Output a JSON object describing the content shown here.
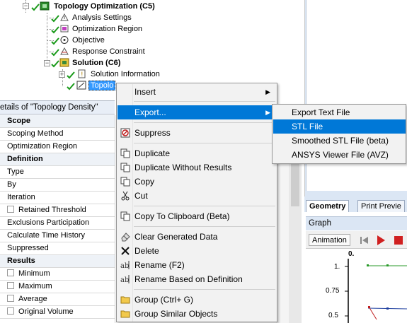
{
  "tree": {
    "nodes": [
      {
        "label": "Topology Optimization (C5)",
        "bold": true
      },
      {
        "label": "Analysis Settings",
        "bold": false
      },
      {
        "label": "Optimization Region",
        "bold": false
      },
      {
        "label": "Objective",
        "bold": false
      },
      {
        "label": "Response Constraint",
        "bold": false
      },
      {
        "label": "Solution (C6)",
        "bold": true
      },
      {
        "label": "Solution Information",
        "bold": false
      },
      {
        "label": "Topolo",
        "bold": false
      }
    ]
  },
  "details": {
    "title": "etails of \"Topology Density\"",
    "rows": [
      {
        "label": "Scope",
        "section": true,
        "checkbox": false
      },
      {
        "label": "Scoping Method",
        "section": false,
        "checkbox": false
      },
      {
        "label": "Optimization Region",
        "section": false,
        "checkbox": false
      },
      {
        "label": "Definition",
        "section": true,
        "checkbox": false
      },
      {
        "label": "Type",
        "section": false,
        "checkbox": false
      },
      {
        "label": "By",
        "section": false,
        "checkbox": false
      },
      {
        "label": "Iteration",
        "section": false,
        "checkbox": false
      },
      {
        "label": "Retained Threshold",
        "section": false,
        "checkbox": true
      },
      {
        "label": "Exclusions Participation",
        "section": false,
        "checkbox": false
      },
      {
        "label": "Calculate Time History",
        "section": false,
        "checkbox": false
      },
      {
        "label": "Suppressed",
        "section": false,
        "checkbox": false
      },
      {
        "label": "Results",
        "section": true,
        "checkbox": false
      },
      {
        "label": "Minimum",
        "section": false,
        "checkbox": true
      },
      {
        "label": "Maximum",
        "section": false,
        "checkbox": true
      },
      {
        "label": "Average",
        "section": false,
        "checkbox": true
      },
      {
        "label": "Original Volume",
        "section": false,
        "checkbox": true
      }
    ]
  },
  "context_menu": {
    "items": [
      {
        "label": "Insert",
        "submenu": true,
        "icon": "none"
      },
      {
        "label": "Export...",
        "submenu": true,
        "icon": "none",
        "highlighted": true
      },
      {
        "label": "Suppress",
        "icon": "suppress-icon"
      },
      {
        "label": "Duplicate",
        "icon": "duplicate-icon"
      },
      {
        "label": "Duplicate Without Results",
        "icon": "duplicate-icon"
      },
      {
        "label": "Copy",
        "icon": "copy-icon"
      },
      {
        "label": "Cut",
        "icon": "scissors-icon"
      },
      {
        "label": "Copy To Clipboard (Beta)",
        "icon": "clipboard-icon"
      },
      {
        "label": "Clear Generated Data",
        "icon": "eraser-icon"
      },
      {
        "label": "Delete",
        "icon": "delete-icon"
      },
      {
        "label": "Rename (F2)",
        "icon": "rename-icon"
      },
      {
        "label": "Rename Based on Definition",
        "icon": "rename-icon"
      },
      {
        "label": "Group (Ctrl+ G)",
        "icon": "folder-icon"
      },
      {
        "label": "Group Similar Objects",
        "icon": "folder-icon"
      }
    ]
  },
  "export_submenu": {
    "items": [
      {
        "label": "Export Text File",
        "highlighted": false
      },
      {
        "label": "STL File",
        "highlighted": true
      },
      {
        "label": "Smoothed STL File (beta)",
        "highlighted": false
      },
      {
        "label": "ANSYS Viewer File (AVZ)",
        "highlighted": false
      }
    ]
  },
  "tabs": {
    "geometry": "Geometry",
    "print_preview": "Print Previe"
  },
  "graph": {
    "title": "Graph",
    "animation_label": "Animation",
    "y_ticks": [
      "1.",
      "0.75",
      "0.5"
    ],
    "top_value": "0."
  },
  "colors": {
    "highlight": "#0078d7",
    "accent_blue": "#3399ff",
    "panel_blue": "#dbe6f4"
  }
}
